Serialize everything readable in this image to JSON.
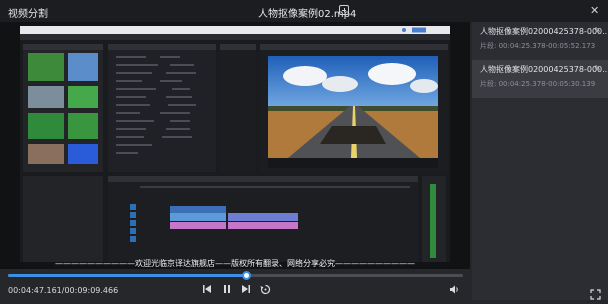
{
  "app": {
    "title": "视频分割"
  },
  "file": {
    "name": "人物抠像案例02.mp4"
  },
  "window": {
    "close_glyph": "✕"
  },
  "icons": {
    "add_file": "plus-square-icon",
    "edit": "pencil-icon",
    "prev": "skip-previous-icon",
    "pause": "pause-icon",
    "next": "skip-next-icon",
    "replay": "replay-icon",
    "volume": "volume-icon",
    "fullscreen": "fullscreen-icon"
  },
  "player": {
    "current_time": "00:04:47.161",
    "total_time": "00:09:09.466",
    "progress": 0.523,
    "watermark": "——————————欢迎光临京译达旗舰店——版权所有翻录、网络分享必究——————————"
  },
  "segments": [
    {
      "name": "人物抠像案例02000425378-000...",
      "range": "片段: 00:04:25.378-00:05:52.173",
      "active": false
    },
    {
      "name": "人物抠像案例02000425378-000...",
      "range": "片段: 00:04:25.378-00:05:30.139",
      "active": true
    }
  ],
  "colors": {
    "accent": "#3b8fe6",
    "sidebar_bg": "#2b2d32",
    "active_item_bg": "#3a3c42"
  }
}
